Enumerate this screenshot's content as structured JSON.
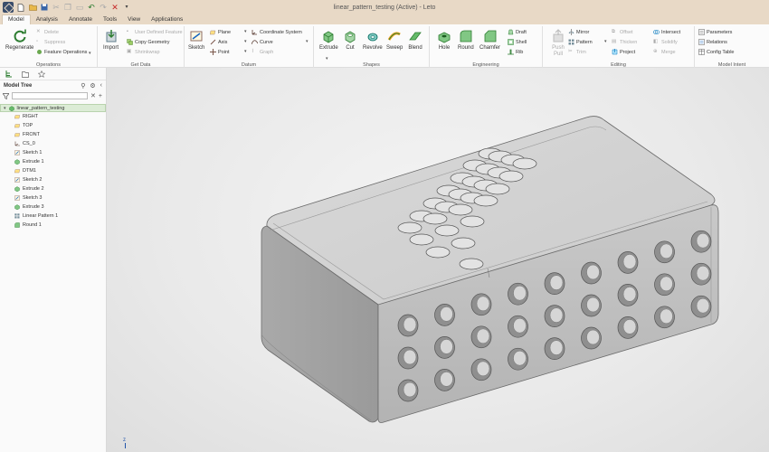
{
  "window": {
    "title": "linear_pattern_testing (Active) - Leto"
  },
  "menu": {
    "tabs": [
      "Model",
      "Analysis",
      "Annotate",
      "Tools",
      "View",
      "Applications"
    ]
  },
  "ribbon": {
    "operations": {
      "title": "Operations",
      "regenerate": "Regenerate",
      "delete": "Delete",
      "suppress": "Suppress",
      "feature_ops": "Feature Operations"
    },
    "getdata": {
      "title": "Get Data",
      "import": "Import",
      "udf": "User Defined Feature",
      "copy_geom": "Copy Geometry",
      "shrinkwrap": "Shrinkwrap"
    },
    "datum": {
      "title": "Datum",
      "sketch": "Sketch",
      "plane": "Plane",
      "axis": "Axis",
      "point": "Point",
      "csys": "Coordinate System",
      "curve": "Curve",
      "graph": "Graph"
    },
    "shapes": {
      "title": "Shapes",
      "extrude": "Extrude",
      "cut": "Cut",
      "revolve": "Revolve",
      "sweep": "Sweep",
      "blend": "Blend"
    },
    "engineering": {
      "title": "Engineering",
      "hole": "Hole",
      "round": "Round",
      "chamfer": "Chamfer",
      "draft": "Draft",
      "shell": "Shell",
      "rib": "Rib"
    },
    "editing": {
      "title": "Editing",
      "pushpull": "Push Pull",
      "mirror": "Mirror",
      "pattern": "Pattern",
      "trim": "Trim",
      "offset": "Offset",
      "thicken": "Thicken",
      "project": "Project",
      "intersect": "Intersect",
      "solidify": "Solidify",
      "merge": "Merge"
    },
    "intent": {
      "title": "Model Intent",
      "parameters": "Parameters",
      "relations": "Relations",
      "config": "Config Table"
    }
  },
  "panel": {
    "title": "Model Tree",
    "root": "linear_pattern_testing",
    "items": [
      "RIGHT",
      "TOP",
      "FRONT",
      "CS_0",
      "Sketch 1",
      "Extrude 1",
      "DTM1",
      "Sketch 2",
      "Extrude 2",
      "Sketch 3",
      "Extrude 3",
      "Linear Pattern 1",
      "Round 1"
    ],
    "icons": [
      "plane-icon",
      "plane-icon",
      "plane-icon",
      "csys-icon",
      "sketch-icon",
      "extrude-icon",
      "plane-icon",
      "sketch-icon",
      "extrude-icon",
      "sketch-icon",
      "extrude-icon",
      "pattern-icon",
      "round-icon"
    ]
  },
  "viewport": {
    "triad_label": "z"
  },
  "colors": {
    "accent": "#2e7d32",
    "titlebar": "#e8d9c6",
    "part": "#c4c4c4"
  }
}
